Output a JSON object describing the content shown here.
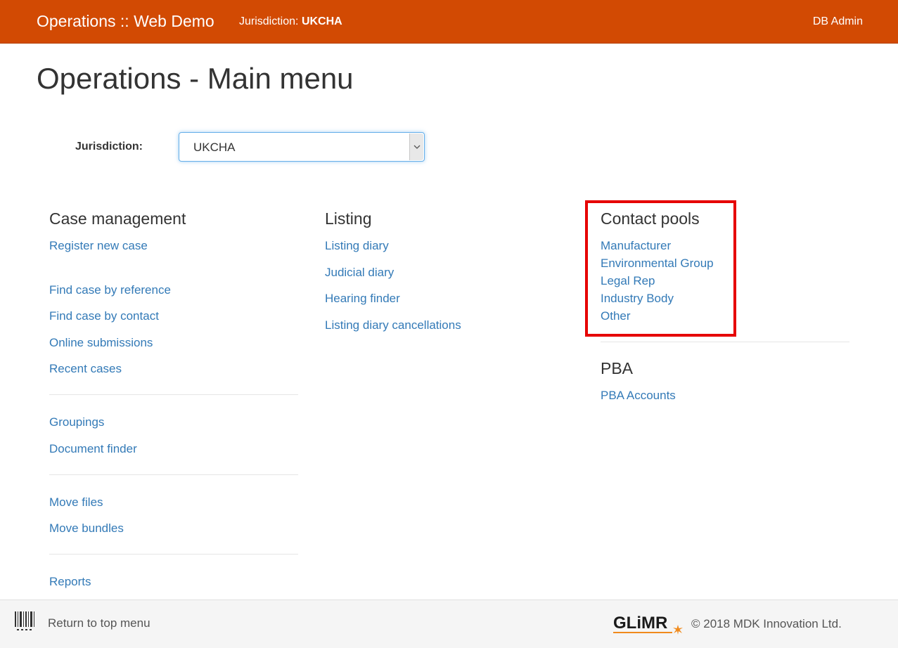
{
  "navbar": {
    "brand": "Operations :: Web Demo",
    "jurisdiction_label": "Jurisdiction:",
    "jurisdiction_value": "UKCHA",
    "user": "DB Admin",
    "color": "#d24a03"
  },
  "page_title": "Operations - Main menu",
  "jurisdiction_select": {
    "label": "Jurisdiction:",
    "selected": "UKCHA"
  },
  "case_management": {
    "heading": "Case management",
    "links": [
      "Register new case",
      "Find case by reference",
      "Find case by contact",
      "Online submissions",
      "Recent cases",
      "Groupings",
      "Document finder",
      "Move files",
      "Move bundles",
      "Reports"
    ]
  },
  "listing": {
    "heading": "Listing",
    "links": [
      "Listing diary",
      "Judicial diary",
      "Hearing finder",
      "Listing diary cancellations"
    ]
  },
  "contact_pools": {
    "heading": "Contact pools",
    "links": [
      "Manufacturer",
      "Environmental Group",
      "Legal Rep",
      "Industry Body",
      "Other"
    ],
    "highlight_color": "#e60000"
  },
  "pba": {
    "heading": "PBA",
    "links": [
      "PBA Accounts"
    ]
  },
  "footer": {
    "return_link": "Return to top menu",
    "logo_text": "GLiMR",
    "copyright": "© 2018 MDK Innovation Ltd."
  },
  "colors": {
    "link": "#337ab7",
    "text": "#333333"
  }
}
